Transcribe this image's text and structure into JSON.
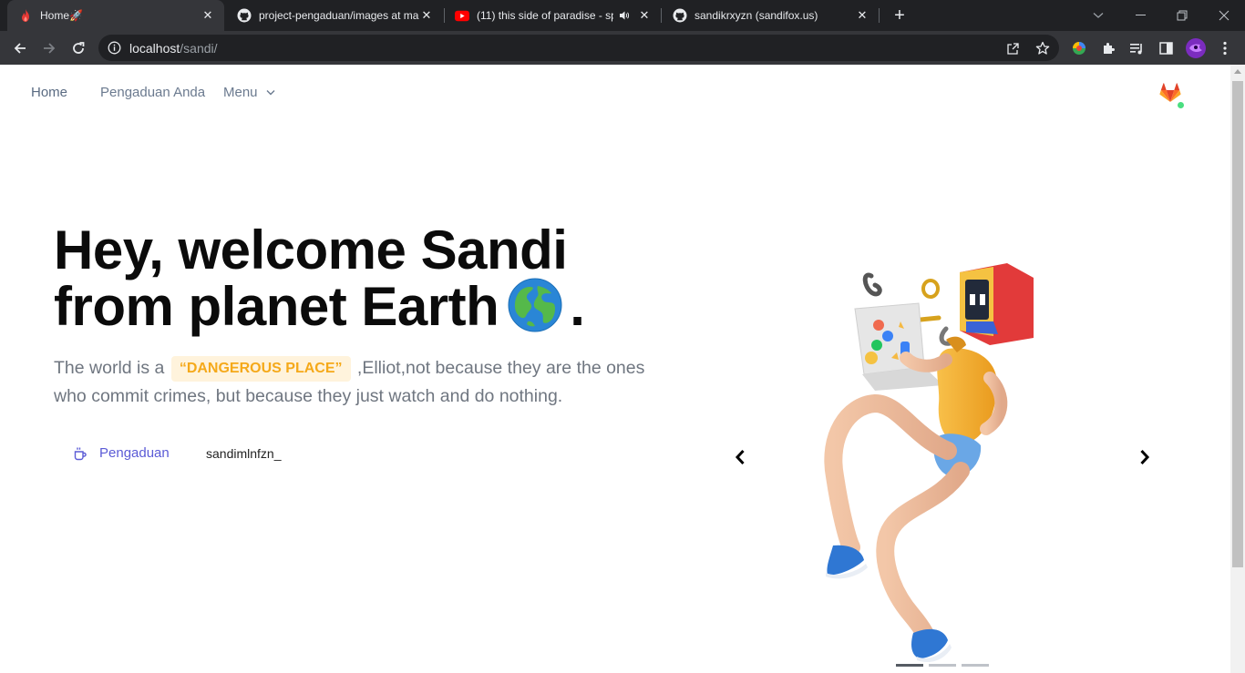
{
  "browser": {
    "tabs": [
      {
        "title": "Home🚀",
        "icon": "fire-icon",
        "active": true
      },
      {
        "title": "project-pengaduan/images at ma",
        "icon": "github-icon",
        "active": false
      },
      {
        "title": "(11) this side of paradise - sp",
        "icon": "youtube-icon",
        "active": false,
        "audio": true
      },
      {
        "title": "sandikrxyzn (sandifox.us)",
        "icon": "github-icon",
        "active": false
      }
    ],
    "url_host": "localhost",
    "url_path": "/sandi/"
  },
  "nav": {
    "home": "Home",
    "pengaduan": "Pengaduan Anda",
    "menu": "Menu"
  },
  "hero": {
    "title_line1": "Hey, welcome Sandi",
    "title_line2": "from planet Earth",
    "title_end": ".",
    "lead_before": "The world is a ",
    "lead_highlight": "“DANGEROUS PLACE”",
    "lead_after": " ,Elliot,not because they are the ones who commit crimes, but because they just watch and do nothing.",
    "cta_label": "Pengaduan",
    "typed_text": "sandimlnfzn_"
  },
  "carousel": {
    "slide_count": 3,
    "active_index": 0
  },
  "colors": {
    "accent": "#5b5bd6",
    "highlight_bg": "#fff3dc",
    "highlight_text": "#f5a91a",
    "online": "#4ade80"
  }
}
